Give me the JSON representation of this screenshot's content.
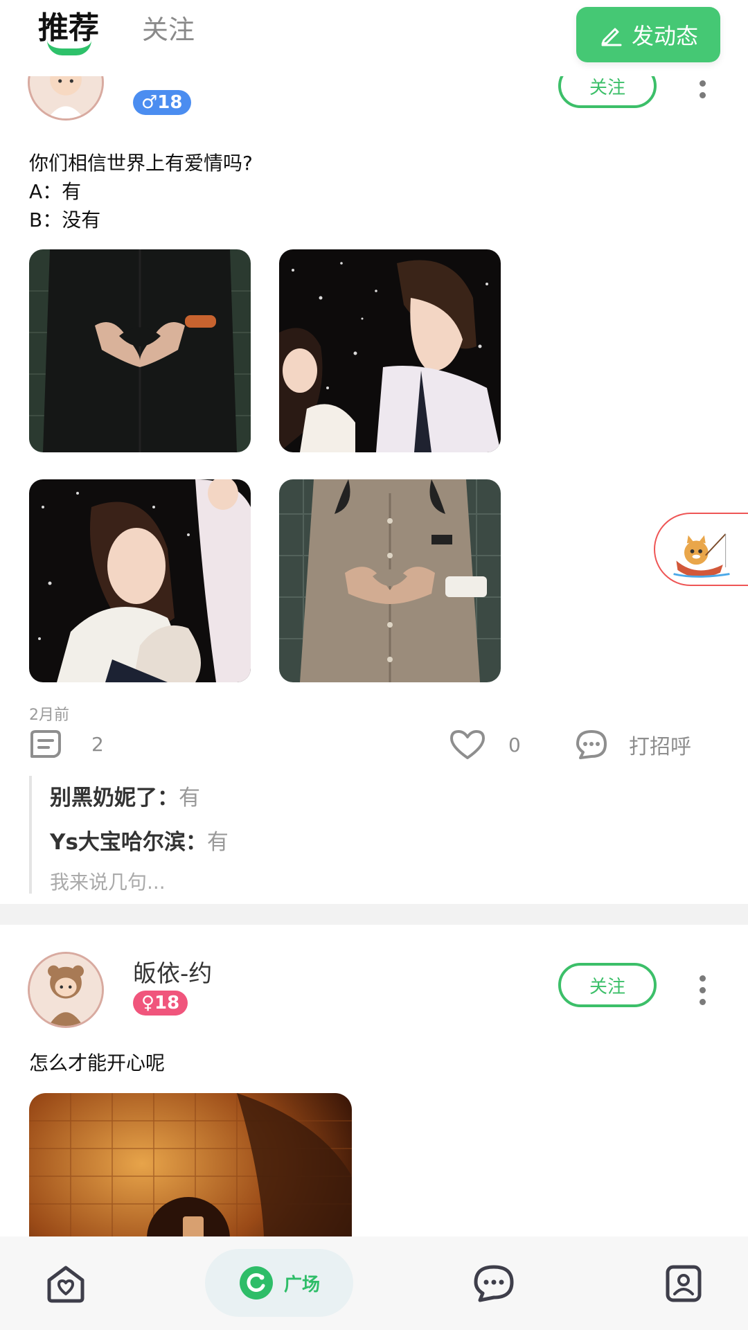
{
  "header": {
    "tabs": [
      {
        "label": "推荐",
        "active": true
      },
      {
        "label": "关注",
        "active": false
      }
    ],
    "post_button_label": "发动态"
  },
  "accent_color": "#45c874",
  "posts": [
    {
      "gender": "male",
      "age_badge": "♂18",
      "follow_label": "关注",
      "content_lines": [
        "你们相信世界上有爱情吗?",
        "A：有",
        "B：没有"
      ],
      "image_count": 4,
      "time": "2月前",
      "comment_count": "2",
      "like_count": "0",
      "greet_label": "打招呼",
      "comments": [
        {
          "user": "别黑奶妮了：",
          "text": "有"
        },
        {
          "user": "Ys大宝哈尔滨：",
          "text": "有"
        }
      ],
      "comment_placeholder": "我来说几句..."
    },
    {
      "username": "皈依-约",
      "gender": "female",
      "age_badge": "♀18",
      "follow_label": "关注",
      "content_lines": [
        "怎么才能开心呢"
      ],
      "image_count": 1
    }
  ],
  "bottom_nav": {
    "items": [
      {
        "name": "home",
        "icon": "home-heart-icon",
        "label": ""
      },
      {
        "name": "square",
        "icon": "square-icon",
        "label": "广场",
        "active": true
      },
      {
        "name": "chat",
        "icon": "chat-bubble-icon",
        "label": ""
      },
      {
        "name": "me",
        "icon": "profile-card-icon",
        "label": ""
      }
    ]
  }
}
